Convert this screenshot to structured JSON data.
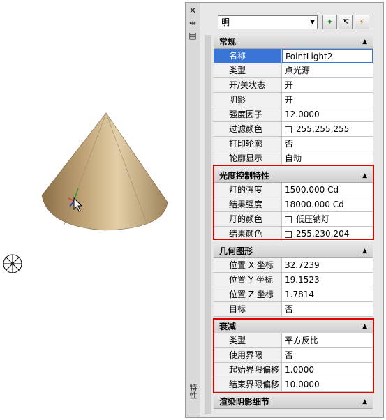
{
  "palette": {
    "side_label": "特性",
    "title_icons": [
      "close-icon",
      "autohide-icon",
      "properties-icon"
    ],
    "selector_value": "明",
    "toolbar_icons": [
      "quick-select-icon",
      "select-objects-icon",
      "toggle-pickadd-icon"
    ]
  },
  "sections": [
    {
      "title": "常规",
      "rows": [
        {
          "key": "名称",
          "value": "PointLight2"
        },
        {
          "key": "类型",
          "value": "点光源"
        },
        {
          "key": "开/关状态",
          "value": "开"
        },
        {
          "key": "阴影",
          "value": "开"
        },
        {
          "key": "强度因子",
          "value": "12.0000"
        },
        {
          "key": "过滤颜色",
          "value": "255,255,255"
        },
        {
          "key": "打印轮廓",
          "value": "否"
        },
        {
          "key": "轮廓显示",
          "value": "自动"
        }
      ]
    },
    {
      "title": "光度控制特性",
      "rows": [
        {
          "key": "灯的强度",
          "value": "1500.000 Cd"
        },
        {
          "key": "结果强度",
          "value": "18000.000 Cd"
        },
        {
          "key": "灯的颜色",
          "value": "低压钠灯"
        },
        {
          "key": "结果颜色",
          "value": "255,230,204"
        }
      ]
    },
    {
      "title": "几何图形",
      "rows": [
        {
          "key": "位置 X 坐标",
          "value": "32.7239"
        },
        {
          "key": "位置 Y 坐标",
          "value": "19.1523"
        },
        {
          "key": "位置 Z 坐标",
          "value": "1.7814"
        },
        {
          "key": "目标",
          "value": "否"
        }
      ]
    },
    {
      "title": "衰减",
      "rows": [
        {
          "key": "类型",
          "value": "平方反比"
        },
        {
          "key": "使用界限",
          "value": "否"
        },
        {
          "key": "起始界限偏移",
          "value": "1.0000"
        },
        {
          "key": "结束界限偏移",
          "value": "10.0000"
        }
      ]
    },
    {
      "title": "渲染阴影细节",
      "rows": []
    }
  ],
  "colors": {
    "highlight_border": "#e00000",
    "selection": "#3875d7",
    "cone_light": "#d9c29a",
    "cone_dark": "#8a6f47"
  }
}
